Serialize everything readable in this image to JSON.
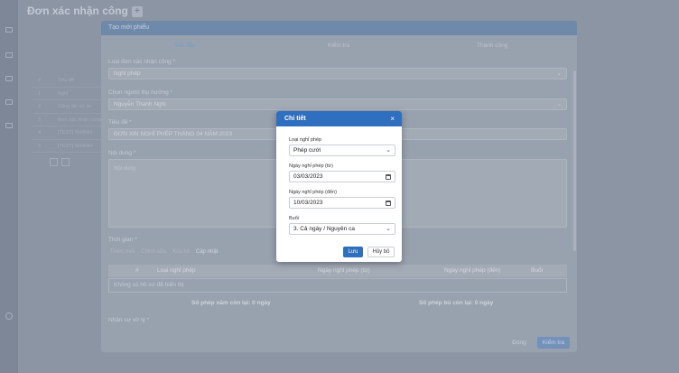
{
  "background": {
    "page_title": "Đơn xác nhận công",
    "table_rows": [
      "Tiêu đề",
      "Nghỉ",
      "Công tác xử án",
      "Đơn xác nhận công",
      "[TEST] NHANH",
      "[TEST] NHANH"
    ]
  },
  "modal": {
    "title": "Tạo mới phiếu",
    "steps": [
      "Bắt đầu",
      "Kiểm tra",
      "Thành công"
    ],
    "fields": {
      "type_label": "Loại đơn xác nhận công *",
      "type_value": "Nghỉ phép",
      "beneficiary_label": "Chọn người thụ hưởng *",
      "beneficiary_value": "Nguyễn Thanh Nghị",
      "title_label": "Tiêu đề *",
      "title_value": "ĐƠN XIN NGHỈ PHÉP THÁNG 04 NĂM 2023",
      "content_label": "Nội dung *",
      "content_placeholder": "Nội dung",
      "time_label": "Thời gian *"
    },
    "toolbar": [
      "Thêm mới",
      "Chỉnh sửa",
      "Xóa bỏ",
      "Cập nhật"
    ],
    "table_headers": [
      "#",
      "Loại nghỉ phép",
      "Ngày nghỉ phép (từ)",
      "Ngày nghỉ phép (đến)",
      "Buổi"
    ],
    "empty_text": "Không có hồ sơ để hiển thị",
    "remaining_annual": "Số phép năm còn lại: 0 ngày",
    "remaining_comp": "Số phép bù còn lại: 0 ngày",
    "handler_label": "Nhân sự xử lý *",
    "close_label": "Đóng",
    "check_label": "Kiểm tra"
  },
  "dialog": {
    "title": "Chi tiết",
    "close_glyph": "×",
    "leave_type_label": "Loại nghỉ phép",
    "leave_type_value": "Phép cưới",
    "date_from_label": "Ngày nghỉ phép (từ)",
    "date_from_value": "03/03/2023",
    "date_to_label": "Ngày nghỉ phép (đến)",
    "date_to_value": "10/03/2023",
    "session_label": "Buổi",
    "session_value": "3. Cả ngày / Nguyên ca",
    "save_label": "Lưu",
    "cancel_label": "Hủy bỏ"
  },
  "colors": {
    "primary": "#2f6fc0",
    "overlay": "#8a94a3"
  }
}
